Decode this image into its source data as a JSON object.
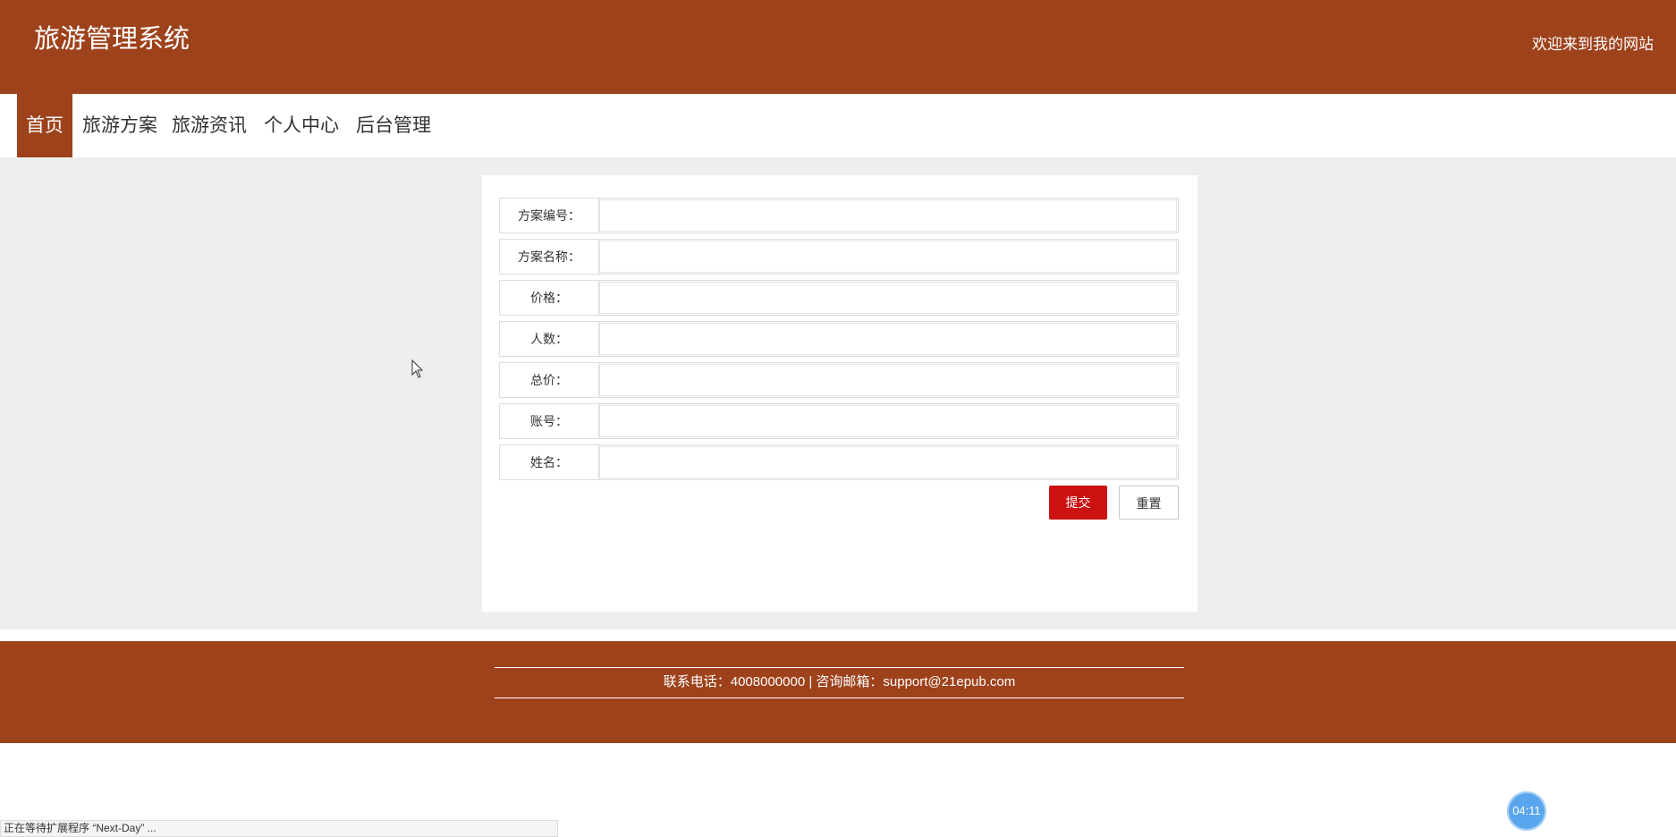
{
  "header": {
    "title": "旅游管理系统",
    "welcome": "欢迎来到我的网站"
  },
  "nav": {
    "items": [
      {
        "label": "首页",
        "active": true
      },
      {
        "label": "旅游方案"
      },
      {
        "label": "旅游资讯"
      },
      {
        "label": "个人中心"
      },
      {
        "label": "后台管理"
      }
    ]
  },
  "form": {
    "fields": [
      {
        "label": "方案编号：",
        "value": "",
        "placeholder": ""
      },
      {
        "label": "方案名称：",
        "value": "",
        "placeholder": ""
      },
      {
        "label": "价格：",
        "value": "",
        "placeholder": ""
      },
      {
        "label": "人数：",
        "value": "",
        "placeholder": ""
      },
      {
        "label": "总价：",
        "value": "",
        "placeholder": ""
      },
      {
        "label": "账号：",
        "value": "",
        "placeholder": ""
      },
      {
        "label": "姓名：",
        "value": "",
        "placeholder": ""
      }
    ],
    "submit_label": "提交",
    "reset_label": "重置"
  },
  "footer": {
    "text": "联系电话：4008000000 | 咨询邮箱：support@21epub.com"
  },
  "status_bar": {
    "text": "正在等待扩展程序 “Next-Day” ..."
  },
  "timer": {
    "text": "04:11"
  },
  "colors": {
    "brand": "#9e421c",
    "submit": "#cc1111",
    "timer": "#5aa6ee"
  },
  "icons": [
    "mouse-pointer-icon"
  ]
}
